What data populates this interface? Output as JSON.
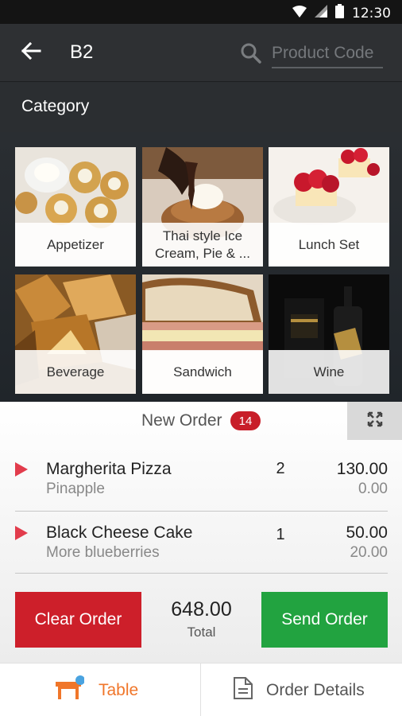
{
  "status_bar": {
    "time": "12:30",
    "icons": [
      "wifi-icon",
      "signal-icon",
      "battery-icon"
    ]
  },
  "app_bar": {
    "title": "B2",
    "back_icon": "arrow-left-icon",
    "search_icon": "search-icon",
    "search_placeholder": "Product Code"
  },
  "category": {
    "label": "Category",
    "items": [
      {
        "label": "Appetizer"
      },
      {
        "label": "Thai style Ice Cream, Pie & ..."
      },
      {
        "label": "Lunch Set"
      },
      {
        "label": "Beverage"
      },
      {
        "label": "Sandwich"
      },
      {
        "label": "Wine"
      }
    ]
  },
  "order": {
    "title": "New Order",
    "badge": "14",
    "expand_icon": "expand-icon",
    "items": [
      {
        "name": "Margherita Pizza",
        "note": "Pinapple",
        "qty": "2",
        "price": "130.00",
        "extra": "0.00"
      },
      {
        "name": "Black Cheese Cake",
        "note": "More blueberries",
        "qty": "1",
        "price": "50.00",
        "extra": "20.00"
      }
    ],
    "clear_label": "Clear Order",
    "send_label": "Send Order",
    "total_amount": "648.00",
    "total_label": "Total",
    "colors": {
      "clear": "#cd1f2a",
      "send": "#22a340",
      "badge": "#c81e29",
      "accent": "#f0762a"
    }
  },
  "bottom_nav": {
    "tabs": [
      {
        "label": "Table",
        "icon": "table-icon",
        "active": true
      },
      {
        "label": "Order Details",
        "icon": "document-icon",
        "active": false
      }
    ]
  }
}
